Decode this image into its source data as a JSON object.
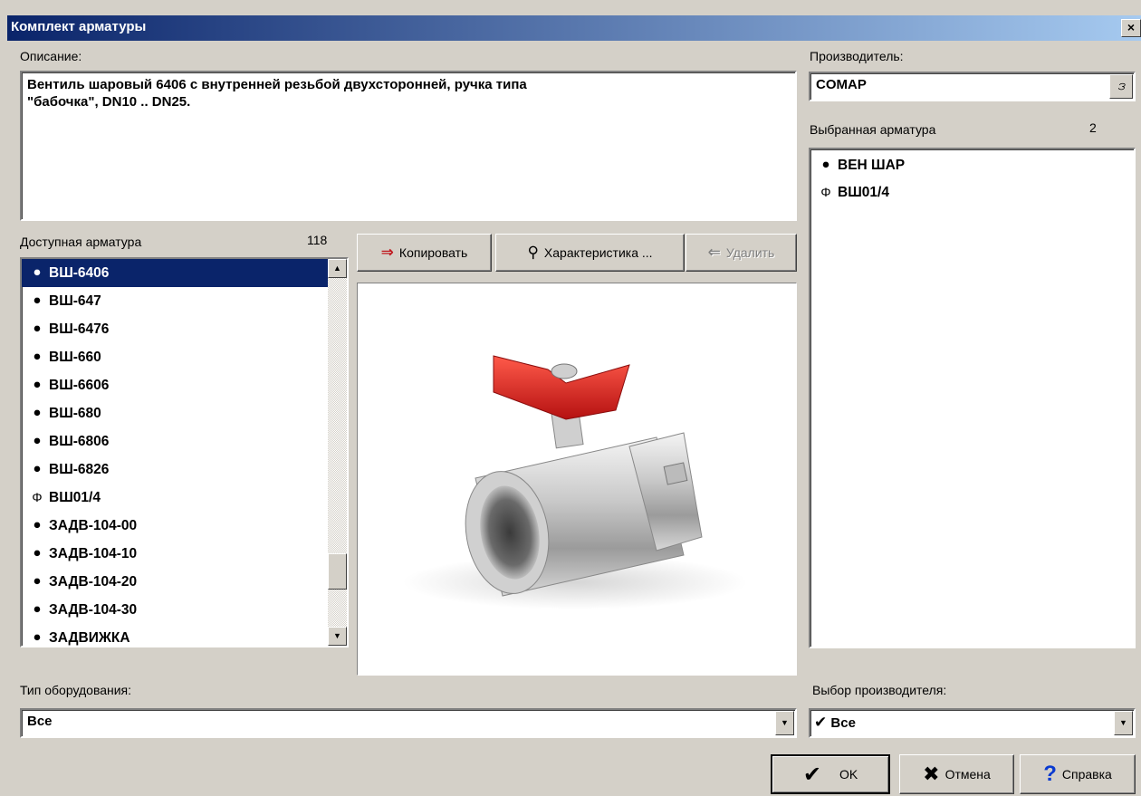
{
  "window": {
    "title": "Комплект арматуры",
    "close_symbol": "×"
  },
  "description": {
    "label": "Описание:",
    "text": "Вентиль шаровый 6406 с внутренней резьбой двухсторонней, ручка типа\n\"бабочка\", DN10 .. DN25."
  },
  "manufacturer": {
    "label": "Производитель:",
    "value": "COMAP",
    "button_icon": "lookup-icon"
  },
  "available": {
    "label": "Доступная арматура",
    "count": "118",
    "items": [
      {
        "label": "ВШ-6406",
        "icon": "ball-valve-icon",
        "selected": true
      },
      {
        "label": "ВШ-647",
        "icon": "ball-valve-icon"
      },
      {
        "label": "ВШ-6476",
        "icon": "ball-valve-icon"
      },
      {
        "label": "ВШ-660",
        "icon": "ball-valve-icon"
      },
      {
        "label": "ВШ-6606",
        "icon": "ball-valve-icon"
      },
      {
        "label": "ВШ-680",
        "icon": "ball-valve-icon"
      },
      {
        "label": "ВШ-6806",
        "icon": "ball-valve-icon"
      },
      {
        "label": "ВШ-6826",
        "icon": "ball-valve-icon"
      },
      {
        "label": "ВШ01/4",
        "icon": "phi-valve-icon"
      },
      {
        "label": "ЗАДВ-104-00",
        "icon": "gate-valve-icon"
      },
      {
        "label": "ЗАДВ-104-10",
        "icon": "gate-valve-icon"
      },
      {
        "label": "ЗАДВ-104-20",
        "icon": "gate-valve-icon"
      },
      {
        "label": "ЗАДВ-104-30",
        "icon": "gate-valve-icon"
      },
      {
        "label": "ЗАДВИЖКА",
        "icon": "gate-valve-icon"
      }
    ]
  },
  "toolbar": {
    "copy": {
      "label": "Копировать",
      "icon": "copy-arrow-icon"
    },
    "properties": {
      "label": "Характеристика ...",
      "icon": "magnifier-icon"
    },
    "remove": {
      "label": "Удалить",
      "icon": "remove-arrow-icon",
      "disabled": true
    }
  },
  "selected": {
    "label": "Выбранная арматура",
    "count": "2",
    "items": [
      {
        "label": "ВЕН ШАР",
        "icon": "ball-valve-icon"
      },
      {
        "label": "ВШ01/4",
        "icon": "phi-valve-icon"
      }
    ]
  },
  "equipment_type": {
    "label": "Тип оборудования:",
    "value": "Все"
  },
  "manufacturer_choice": {
    "label": "Выбор производителя:",
    "value": "Все",
    "icon": "checkmark-icon"
  },
  "buttons": {
    "ok": "OK",
    "cancel": "Отмена",
    "help": "Справка"
  },
  "colors": {
    "titlebar": "#0a246a",
    "selection": "#0a246a",
    "face": "#d4d0c8",
    "handle": "#d32222"
  }
}
